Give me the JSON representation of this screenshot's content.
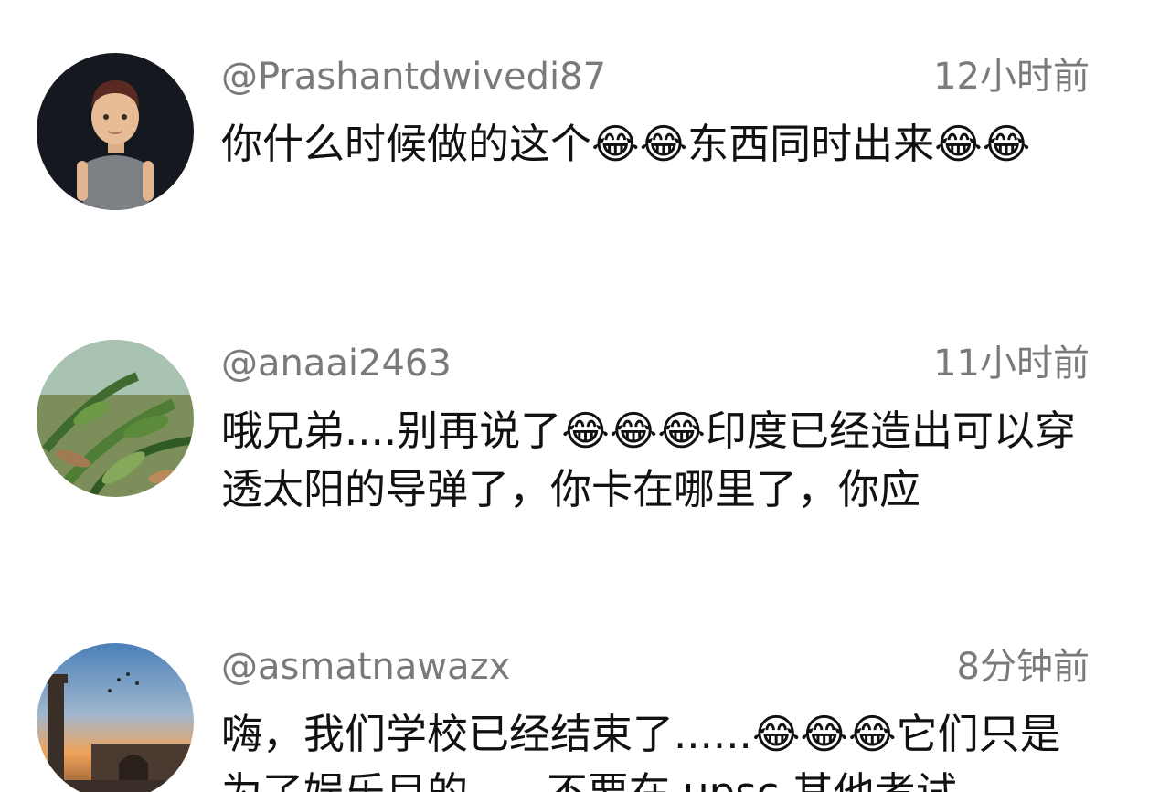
{
  "comments": [
    {
      "username": "@Prashantdwivedi87",
      "time": "12小时前",
      "text": "你什么时候做的这个😂😂东西同时出来😂😂"
    },
    {
      "username": "@anaai2463",
      "time": "11小时前",
      "text": "哦兄弟....别再说了😂😂😂印度已经造出可以穿透太阳的导弹了，你卡在哪里了，你应"
    },
    {
      "username": "@asmatnawazx",
      "time": "8分钟前",
      "text": "嗨，我们学校已经结束了......😂😂😂它们只是为了娱乐目的......不要在 upsc 其他考试"
    }
  ]
}
